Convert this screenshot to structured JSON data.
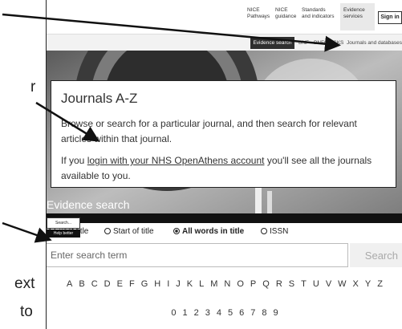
{
  "left_fragments": [
    "r",
    "ext",
    "to"
  ],
  "top_nav": {
    "items": [
      {
        "line1": "NICE",
        "line2": "Pathways"
      },
      {
        "line1": "NICE",
        "line2": "guidance"
      },
      {
        "line1": "Standards",
        "line2": "and indicators"
      },
      {
        "line1": "Evidence",
        "line2": "services"
      }
    ],
    "sign_in": "Sign in"
  },
  "sub_nav": {
    "active": "Evidence search",
    "items": [
      "BNF",
      "BNFC",
      "CKS",
      "Journals and databases"
    ]
  },
  "journals_box": {
    "title": "Journals A-Z",
    "paragraph1": "Browse or search for a particular journal, and then search for relevant articles within that journal.",
    "p2_prefix": "If you ",
    "p2_link": "login with your NHS OpenAthens account",
    "p2_suffix": " you'll see all the journals available to you."
  },
  "evidence_search_label": "Evidence search",
  "tiny_search": "Search...",
  "help_better": "Help better",
  "radios": [
    {
      "label": "Exact title",
      "checked": false
    },
    {
      "label": "Start of title",
      "checked": false
    },
    {
      "label": "All words in title",
      "checked": true
    },
    {
      "label": "ISSN",
      "checked": false
    }
  ],
  "search": {
    "placeholder": "Enter search term",
    "button": "Search"
  },
  "letters": [
    "A",
    "B",
    "C",
    "D",
    "E",
    "F",
    "G",
    "H",
    "I",
    "J",
    "K",
    "L",
    "M",
    "N",
    "O",
    "P",
    "Q",
    "R",
    "S",
    "T",
    "U",
    "V",
    "W",
    "X",
    "Y",
    "Z"
  ],
  "digits": [
    "0",
    "1",
    "2",
    "3",
    "4",
    "5",
    "6",
    "7",
    "8",
    "9"
  ]
}
